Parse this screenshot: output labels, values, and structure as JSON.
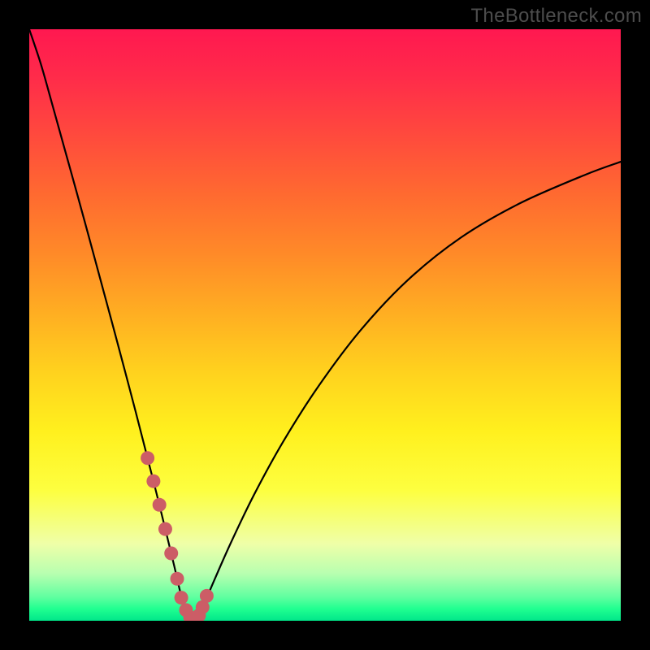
{
  "watermark": {
    "text": "TheBottleneck.com"
  },
  "colors": {
    "background_outer": "#000000",
    "gradient_top": "#ff1850",
    "gradient_bottom": "#00e68a",
    "curve_stroke": "#000000",
    "marker_fill": "#cc5d66",
    "watermark_text": "#4c4c4c"
  },
  "chart_data": {
    "type": "line",
    "title": "",
    "xlabel": "",
    "ylabel": "",
    "xlim": [
      0,
      100
    ],
    "ylim": [
      0,
      100
    ],
    "grid": false,
    "series": [
      {
        "name": "bottleneck-curve",
        "x": [
          0,
          2,
          4,
          6,
          8,
          10,
          12,
          14,
          16,
          18,
          19,
          20,
          21.5,
          23,
          24.5,
          25.5,
          26.5,
          27.5,
          28,
          28.5,
          29,
          31,
          34,
          38,
          43,
          49,
          56,
          64,
          73,
          83,
          94,
          100
        ],
        "values": [
          100,
          94,
          86.9,
          79.7,
          72.5,
          65.2,
          57.8,
          50.4,
          42.9,
          35.3,
          31.4,
          27.5,
          21.6,
          15.5,
          9.3,
          5.0,
          1.8,
          0.3,
          0.1,
          0.5,
          1.4,
          6.2,
          13.0,
          21.3,
          30.4,
          39.8,
          49.1,
          57.6,
          64.8,
          70.6,
          75.4,
          77.6
        ]
      }
    ],
    "markers": {
      "name": "highlight-segment",
      "x": [
        20,
        21,
        22,
        23,
        24,
        25,
        25.7,
        26.5,
        27.2,
        28,
        28.7,
        29.3,
        30
      ],
      "values": [
        27.5,
        23.6,
        19.6,
        15.5,
        11.4,
        7.1,
        3.9,
        1.8,
        0.6,
        0.1,
        0.9,
        2.3,
        4.2
      ]
    }
  }
}
